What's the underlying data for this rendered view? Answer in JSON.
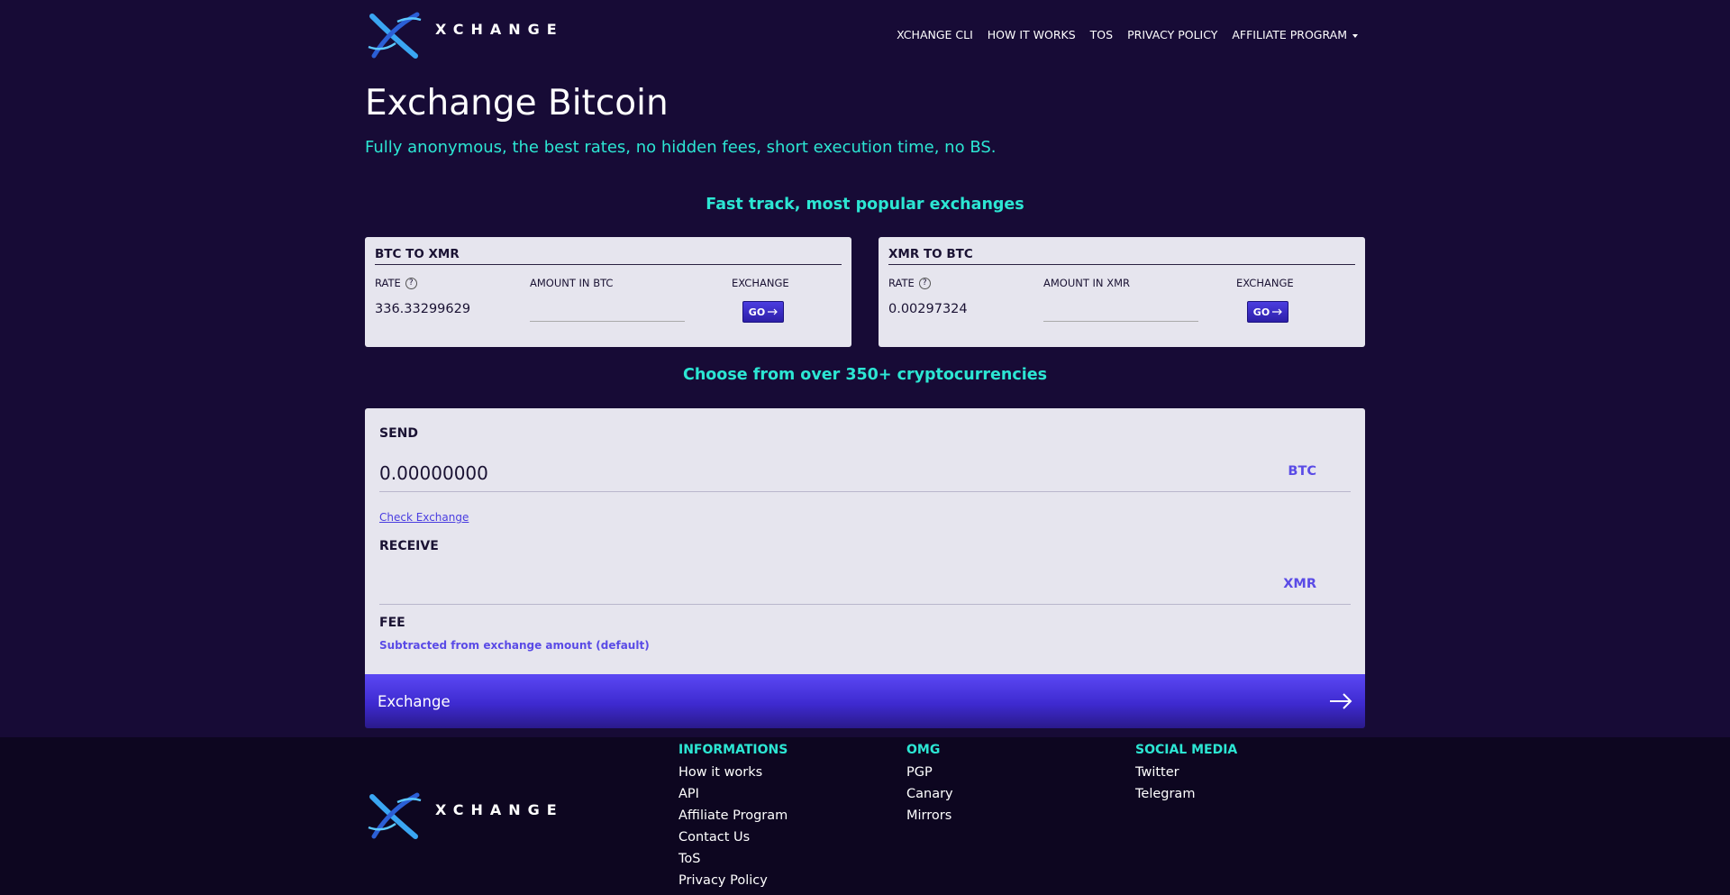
{
  "brand": {
    "name": "XCHANGE"
  },
  "nav": {
    "items": [
      "XCHANGE CLI",
      "HOW IT WORKS",
      "TOS",
      "PRIVACY POLICY"
    ],
    "dropdown": "AFFILIATE PROGRAM"
  },
  "hero": {
    "title": "Exchange Bitcoin",
    "subtitle": "Fully anonymous, the best rates, no hidden fees, short execution time, no BS."
  },
  "fast_track": {
    "title": "Fast track, most popular exchanges",
    "cards": [
      {
        "title": "BTC TO XMR",
        "rate_label": "RATE",
        "help": "?",
        "rate": "336.33299629",
        "amount_label": "AMOUNT IN BTC",
        "amount_value": "",
        "exchange_label": "EXCHANGE",
        "go_label": "GO"
      },
      {
        "title": "XMR TO BTC",
        "rate_label": "RATE",
        "help": "?",
        "rate": "0.00297324",
        "amount_label": "AMOUNT IN XMR",
        "amount_value": "",
        "exchange_label": "EXCHANGE",
        "go_label": "GO"
      }
    ]
  },
  "choose": {
    "title": "Choose from over 350+ cryptocurrencies"
  },
  "exchange_form": {
    "send_label": "SEND",
    "send_value": "0.00000000",
    "send_currency": "BTC",
    "check_link": "Check Exchange",
    "receive_label": "RECEIVE",
    "receive_value": "",
    "receive_currency": "XMR",
    "fee_label": "FEE",
    "fee_note": "Subtracted from exchange amount (default)",
    "submit_label": "Exchange"
  },
  "footer": {
    "columns": [
      {
        "title": "INFORMATIONS",
        "links": [
          "How it works",
          "API",
          "Affiliate Program",
          "Contact Us",
          "ToS",
          "Privacy Policy"
        ]
      },
      {
        "title": "OMG",
        "links": [
          "PGP",
          "Canary",
          "Mirrors"
        ]
      },
      {
        "title": "SOCIAL MEDIA",
        "links": [
          "Twitter",
          "Telegram"
        ]
      }
    ]
  },
  "colors": {
    "background": "#170b36",
    "accent": "#2ce6d3",
    "button": "#4b3de0",
    "panel": "#e6e5ee"
  }
}
